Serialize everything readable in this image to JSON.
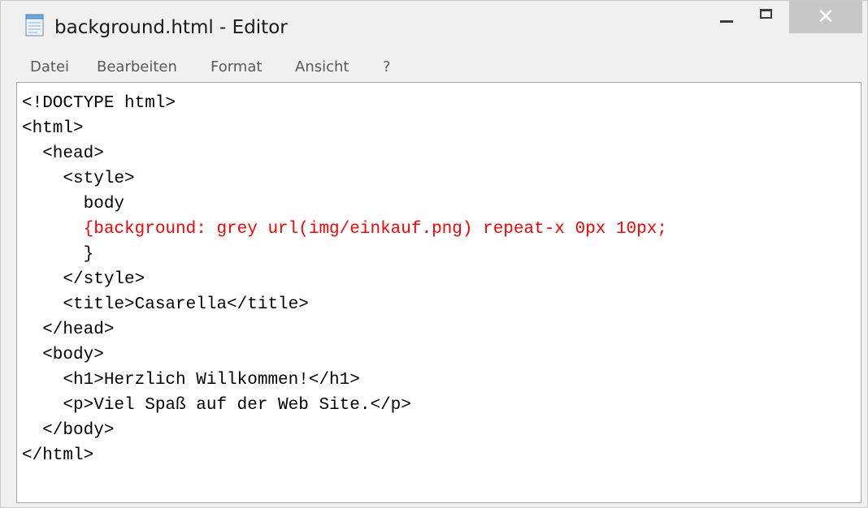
{
  "window": {
    "title": "background.html - Editor",
    "close_glyph": "✕",
    "icons": {
      "app": "notepad-icon",
      "minimize": "minimize-icon",
      "maximize": "maximize-icon",
      "close": "close-icon"
    }
  },
  "menu": {
    "items": [
      "Datei",
      "Bearbeiten",
      "Format",
      "Ansicht",
      "?"
    ]
  },
  "editor": {
    "highlight_color": "#ff0000",
    "lines": [
      "<!DOCTYPE html>",
      "<html>",
      "  <head>",
      "    <style>",
      "      body",
      "      {background: grey url(img/einkauf.png) repeat-x 0px 10px;",
      "      }",
      "    </style>",
      "    <title>Casarella</title>",
      "  </head>",
      "  <body>",
      "    <h1>Herzlich Willkommen!</h1>",
      "    <p>Viel Spaß auf der Web Site.</p>",
      "  </body>",
      "</html>"
    ]
  }
}
